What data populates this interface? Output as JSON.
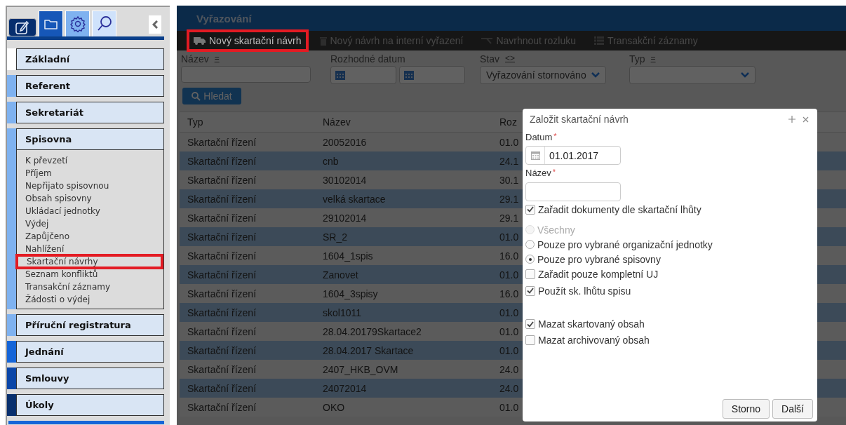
{
  "sidebar": {
    "tabs": [
      {
        "kind": "edit",
        "selected": true
      },
      {
        "kind": "folder",
        "selected": false
      },
      {
        "kind": "gear",
        "selected": false
      },
      {
        "kind": "search",
        "selected": false
      }
    ],
    "sections": [
      {
        "label": "Základní",
        "color": "#ffffff"
      },
      {
        "label": "Referent",
        "color": "#7fb2f0"
      },
      {
        "label": "Sekretariát",
        "color": "#7fb2f0"
      },
      {
        "label": "Spisovna",
        "color": "#7fb2f0",
        "items": [
          {
            "label": "K převzetí",
            "selected": false
          },
          {
            "label": "Příjem",
            "selected": false
          },
          {
            "label": "Nepřijato spisovnou",
            "selected": false
          },
          {
            "label": "Obsah spisovny",
            "selected": false
          },
          {
            "label": "Ukládací jednotky",
            "selected": false
          },
          {
            "label": "Výdej",
            "selected": false
          },
          {
            "label": "Zapůjčeno",
            "selected": false
          },
          {
            "label": "Nahlížení",
            "selected": false
          },
          {
            "label": "Skartační návrhy",
            "selected": true
          },
          {
            "label": "Seznam konfliktů",
            "selected": false
          },
          {
            "label": "Transakční záznamy",
            "selected": false
          },
          {
            "label": "Žádosti o výdej",
            "selected": false
          }
        ]
      },
      {
        "label": "Příruční registratura",
        "color": "#7fb2f0"
      },
      {
        "label": "Jednání",
        "color": "#1565d8"
      },
      {
        "label": "Smlouvy",
        "color": "#0a46a8"
      },
      {
        "label": "Úkoly",
        "color": "#08306e"
      }
    ]
  },
  "page": {
    "title": "Vyřazování",
    "toolbar": [
      {
        "kind": "truck",
        "label": "Nový skartační návrh",
        "highlighted": true
      },
      {
        "kind": "trash",
        "label": "Nový návrh na interní vyřazení",
        "highlighted": false
      },
      {
        "kind": "split",
        "label": "Navrhnout rozluku",
        "highlighted": false
      },
      {
        "kind": "list",
        "label": "Transakční záznamy",
        "highlighted": false
      }
    ],
    "filters": [
      {
        "kind": "text",
        "label": "Název",
        "operator": "="
      },
      {
        "kind": "daterange",
        "label": "Rozhodné datum"
      },
      {
        "kind": "select",
        "label": "Stav",
        "operator": "<>",
        "value": "Vyřazování stornováno"
      },
      {
        "kind": "select",
        "label": "Typ",
        "operator": "="
      }
    ],
    "search_button": "Hledat",
    "table": {
      "columns": [
        "Typ",
        "Název",
        "Roz"
      ],
      "rows": [
        [
          "Skartační řízení",
          "20052016",
          "01.0"
        ],
        [
          "Skartační řízení",
          "cnb",
          "24.1"
        ],
        [
          "Skartační řízení",
          "30102014",
          "30.1"
        ],
        [
          "Skartační řízení",
          "velká skartace",
          "29.1"
        ],
        [
          "Skartační řízení",
          "29102014",
          "29.1"
        ],
        [
          "Skartační řízení",
          "SR_2",
          "01.0"
        ],
        [
          "Skartační řízení",
          "1604_1spis",
          "16.0"
        ],
        [
          "Skartační řízení",
          "Zanovet",
          "01.0"
        ],
        [
          "Skartační řízení",
          "1604_3spisy",
          "16.0"
        ],
        [
          "Skartační řízení",
          "skol1011",
          "01.0"
        ],
        [
          "Skartační řízení",
          "28.04.20179Skartace2",
          "01.0"
        ],
        [
          "Skartační řízení",
          "28.04.2017 Skartace",
          "01.0"
        ],
        [
          "Skartační řízení",
          "2407_HKB_OVM",
          "24.0"
        ],
        [
          "Skartační řízení",
          "24072014",
          "24.0"
        ],
        [
          "Skartační řízení",
          "OKO",
          "01.0"
        ]
      ]
    }
  },
  "dialog": {
    "title": "Založit skartační návrh",
    "date_label": "Datum",
    "date_marker": "*",
    "date_value": "01.01.2017",
    "name_label": "Název",
    "name_marker": "*",
    "options": [
      {
        "kind": "checkbox",
        "label": "Zařadit dokumenty dle skartační lhůty",
        "checked": true
      },
      {
        "kind": "radio",
        "label": "Všechny",
        "checked": false,
        "disabled": true
      },
      {
        "kind": "radio",
        "label": "Pouze pro vybrané organizační jednotky",
        "checked": false
      },
      {
        "kind": "radio",
        "label": "Pouze pro vybrané spisovny",
        "checked": true
      },
      {
        "kind": "checkbox",
        "label": "Zařadit pouze kompletní UJ",
        "checked": false
      },
      {
        "kind": "checkbox",
        "label": "Použít sk. lhůtu spisu",
        "checked": true
      },
      {
        "kind": "checkbox",
        "label": "Mazat skartovaný obsah",
        "checked": true
      },
      {
        "kind": "checkbox",
        "label": "Mazat archivovaný obsah",
        "checked": false
      }
    ],
    "buttons": [
      "Storno",
      "Další"
    ]
  }
}
